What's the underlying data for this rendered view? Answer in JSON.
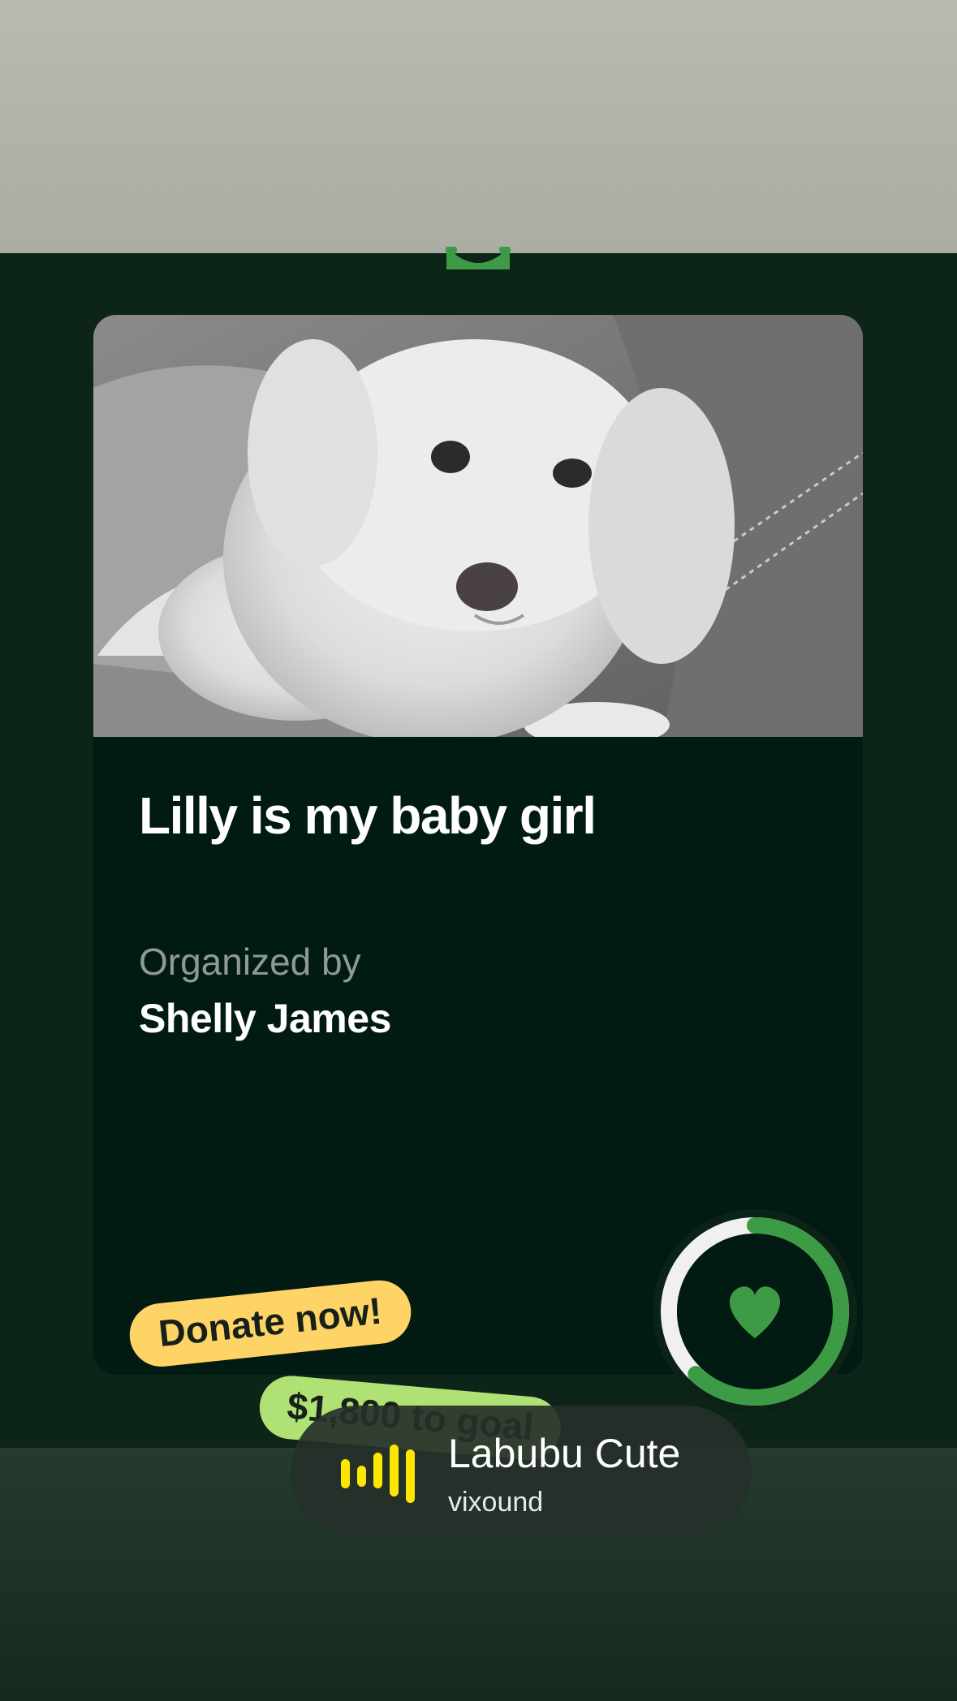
{
  "campaign": {
    "title": "Lilly is my baby girl",
    "organizer_label": "Organized by",
    "organizer_name": "Shelly James",
    "photo": "white-poodle-dog-photo",
    "progress_ring_fraction": 0.62
  },
  "stickers": {
    "donate": "Donate now!",
    "goal": "$1,800 to goal"
  },
  "music": {
    "title": "Labubu Cute",
    "artist": "vixound",
    "icon": "sound-waveform-icon"
  },
  "colors": {
    "accent_green": "#3e9b45",
    "card_bg": "#021b12",
    "donate_yellow": "#ffd466",
    "goal_green": "#b8ec7a",
    "music_icon_yellow": "#ffe600"
  }
}
